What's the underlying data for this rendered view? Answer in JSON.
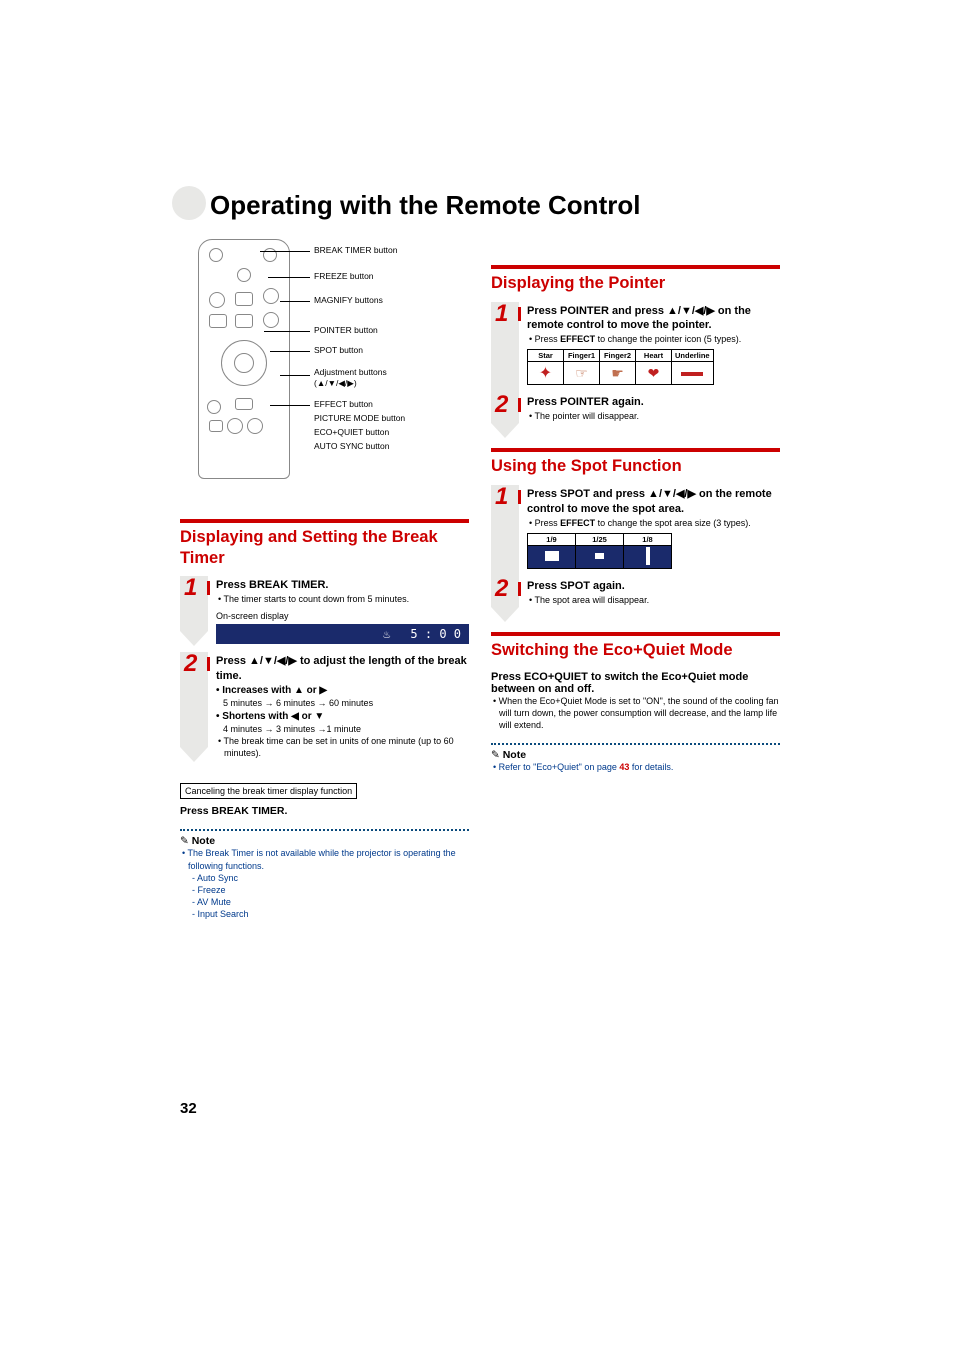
{
  "page_number": "32",
  "title": "Operating with the Remote Control",
  "remote_labels": [
    "BREAK TIMER button",
    "FREEZE button",
    "MAGNIFY buttons",
    "POINTER button",
    "SPOT button",
    "Adjustment buttons",
    "(▲/▼/◀/▶)",
    "EFFECT button",
    "PICTURE MODE button",
    "ECO+QUIET button",
    "AUTO SYNC button"
  ],
  "left": {
    "section_title": "Displaying and Setting the Break Timer",
    "step1_title_a": "Press ",
    "step1_title_b": "BREAK TIMER",
    "step1_title_c": ".",
    "step1_body": "The timer starts to count down from 5 minutes.",
    "osd_label": "On-screen display",
    "osd_time": "5 : 0 0",
    "step2_title": "Press ▲/▼/◀/▶ to adjust the length of the break time.",
    "step2_inc_hd": "• Increases with ▲ or ▶",
    "step2_inc_body": "5 minutes → 6 minutes → 60 minutes",
    "step2_dec_hd": "• Shortens with ◀ or ▼",
    "step2_dec_body": "4 minutes → 3 minutes →1 minute",
    "step2_foot": "The break time can be set in units of one minute (up to 60 minutes).",
    "cancel_box": "Canceling the break timer display function",
    "press_a": "Press ",
    "press_b": "BREAK TIMER",
    "press_c": ".",
    "note_hd": "Note",
    "note_body": "The Break Timer is not available while the projector is operating the following functions.",
    "note_items": [
      "- Auto Sync",
      "- Freeze",
      "- AV Mute",
      "- Input Search"
    ]
  },
  "pointer": {
    "section_title": "Displaying the Pointer",
    "step1_title": "Press POINTER and press ▲/▼/◀/▶ on the remote control to move the pointer.",
    "step1_body_a": "Press ",
    "step1_body_b": "EFFECT",
    "step1_body_c": " to change the pointer icon (5 types).",
    "icons": [
      "Star",
      "Finger1",
      "Finger2",
      "Heart",
      "Underline"
    ],
    "step2_title_a": "Press ",
    "step2_title_b": "POINTER",
    "step2_title_c": " again.",
    "step2_body": "The pointer will disappear."
  },
  "spot": {
    "section_title": "Using the Spot Function",
    "step1_title": "Press SPOT and press ▲/▼/◀/▶ on the remote control to move the spot area.",
    "step1_body_a": "Press ",
    "step1_body_b": "EFFECT",
    "step1_body_c": " to change the spot area size (3 types).",
    "sizes": [
      "1/9",
      "1/25",
      "1/8"
    ],
    "step2_title_a": "Press ",
    "step2_title_b": "SPOT",
    "step2_title_c": " again.",
    "step2_body": "The spot area will disappear."
  },
  "eco": {
    "section_title": "Switching the Eco+Quiet Mode",
    "press_a": "Press ",
    "press_b": "ECO+QUIET",
    "press_c": " to switch the Eco+Quiet mode between on and off.",
    "body": "When the Eco+Quiet Mode is set to \"ON\", the sound of the cooling fan will turn down, the power consumption will decrease, and the lamp life will extend.",
    "note_hd": "Note",
    "note_body_a": "Refer to \"Eco+Quiet\" on page ",
    "note_page": "43",
    "note_body_b": " for details."
  }
}
